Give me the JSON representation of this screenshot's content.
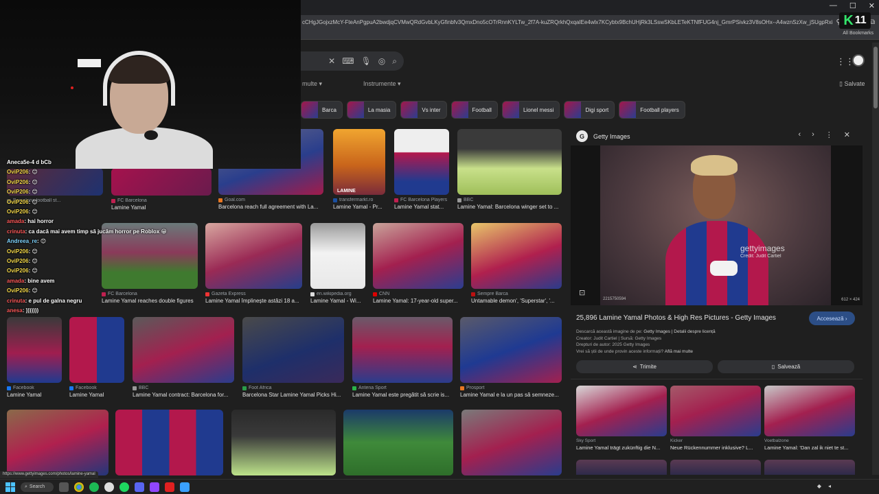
{
  "browser": {
    "url": "cCHgJGojxzMcY-FteAnPgpuA2bwdjqCVMwQRdGvbLKyGfinbfv3QmxDno5cOTrRnnKYLTw_2f7A-kuZRQrkhQxqaIEe4wlx7KCybtx9BchUHjRk3LSswSKbLETeKTNfFUG4nj_GmrPSivkz3V8sOHx--A4wznSzXw_jSUgpRxiUh669_Erz1CjQ...",
    "all_bookmarks": "All Bookmarks",
    "overlay_logo_k": "K",
    "overlay_logo_num": "11"
  },
  "header": {
    "tools_left": "multe ▾",
    "tools_right": "Instrumente ▾",
    "saved": "Salvate"
  },
  "chips": [
    {
      "label": "Barca"
    },
    {
      "label": "La masia"
    },
    {
      "label": "Vs inter"
    },
    {
      "label": "Football"
    },
    {
      "label": "Lionel messi"
    },
    {
      "label": "Digi sport"
    },
    {
      "label": "Football players"
    }
  ],
  "results": [
    {
      "source": "Barcelona football st...",
      "title": ""
    },
    {
      "source": "FC Barcelona",
      "title": "Lamine Yamal"
    },
    {
      "source": "Goal.com",
      "title": "Barcelona reach full agreement with La..."
    },
    {
      "source": "transfermarkt.ro",
      "title": "Lamine Yamal - Pr..."
    },
    {
      "source": "FC Barcelona Players",
      "title": "Lamine Yamal stat..."
    },
    {
      "source": "BBC",
      "title": "Lamine Yamal: Barcelona winger set to ..."
    },
    {
      "source": "FC Barcelona",
      "title": "Lamine Yamal reaches double figures"
    },
    {
      "source": "Gazeta Express",
      "title": "Lamine Yamal împlinește astăzi 18 a..."
    },
    {
      "source": "en.wikipedia.org",
      "title": "Lamine Yamal - Wi..."
    },
    {
      "source": "CNN",
      "title": "Lamine Yamal: 17-year-old super..."
    },
    {
      "source": "Sempre Barca",
      "title": "Untamable demon', 'Superstar', '..."
    },
    {
      "source": "Facebook",
      "title": "Lamine Yamal"
    },
    {
      "source": "Facebook",
      "title": "Lamine Yamal"
    },
    {
      "source": "BBC",
      "title": "Lamine Yamal contract: Barcelona for..."
    },
    {
      "source": "Foot Africa",
      "title": "Barcelona Star Lamine Yamal Picks Hi..."
    },
    {
      "source": "Antena Sport",
      "title": "Lamine Yamal este pregătit să scrie is..."
    },
    {
      "source": "Prosport",
      "title": "Lamine Yamal e la un pas să semneze..."
    }
  ],
  "card_lamine_text": "LAMINE",
  "panel": {
    "source": "Getty Images",
    "logo_letter": "G",
    "watermark": "gettyimages",
    "credit": "Credit: Judit Cartiel",
    "image_id": "2215750594",
    "image_size": "612 × 424",
    "title": "25,896 Lamine Yamal Photos & High Res Pictures - Getty Images",
    "visit": "Accesează ›",
    "meta_line1_pre": "Descarcă această imagine de pe:",
    "meta_line1_src": "Getty Images",
    "meta_line1_link": "| Detalii despre licență",
    "meta_line2": "Creator: Judit Cartiel | Sursă: Getty Images",
    "meta_line3": "Drepturi de autor: 2025 Getty Images",
    "meta_line4_pre": "Vrei să știi de unde provin aceste informații?",
    "meta_line4_link": "Află mai multe",
    "share": "Trimite",
    "save": "Salvează",
    "related": [
      {
        "source": "Sky Sport",
        "title": "Lamine Yamal trägt zukünftig die N..."
      },
      {
        "source": "Kicker",
        "title": "Neue Rückennummer inklusive? L..."
      },
      {
        "source": "Voetbalzone",
        "title": "Lamine Yamal: 'Dan zal ik niet te st..."
      }
    ]
  },
  "chat": [
    {
      "name": "",
      "text": "Aneca5e-4 d bCb"
    },
    {
      "name": "OviP206",
      "text": ": 😊"
    },
    {
      "name": "OviP206",
      "text": ": 😊"
    },
    {
      "name": "OviP206",
      "text": ": 😊"
    },
    {
      "name": "OviP206",
      "text": ": 😊"
    },
    {
      "name": "OviP206",
      "text": ": 😊"
    },
    {
      "name": "amada",
      "text": ": hai horror"
    },
    {
      "name": "crinuta",
      "text": ": ca dacă mai avem timp să jucăm horror pe Roblox 😁"
    },
    {
      "name": "Andreea_re",
      "text": ": 😊"
    },
    {
      "name": "OviP206",
      "text": ": 😊"
    },
    {
      "name": "OviP206",
      "text": ": 😊"
    },
    {
      "name": "OviP206",
      "text": ": 😊"
    },
    {
      "name": "amada",
      "text": ": bine avem"
    },
    {
      "name": "OviP206",
      "text": ": 😊"
    },
    {
      "name": "crinuta",
      "text": ": e pul de galna negru"
    },
    {
      "name": "anesa",
      "text": ": )))))))"
    }
  ],
  "status_url": "https://www.gettyimages.com/photos/lamine-yamal",
  "taskbar": {
    "search": "Search"
  },
  "colors": {
    "background": "#1f1f1f",
    "accent_button": "#2c4e86",
    "chat_name": "#f5d94a"
  }
}
